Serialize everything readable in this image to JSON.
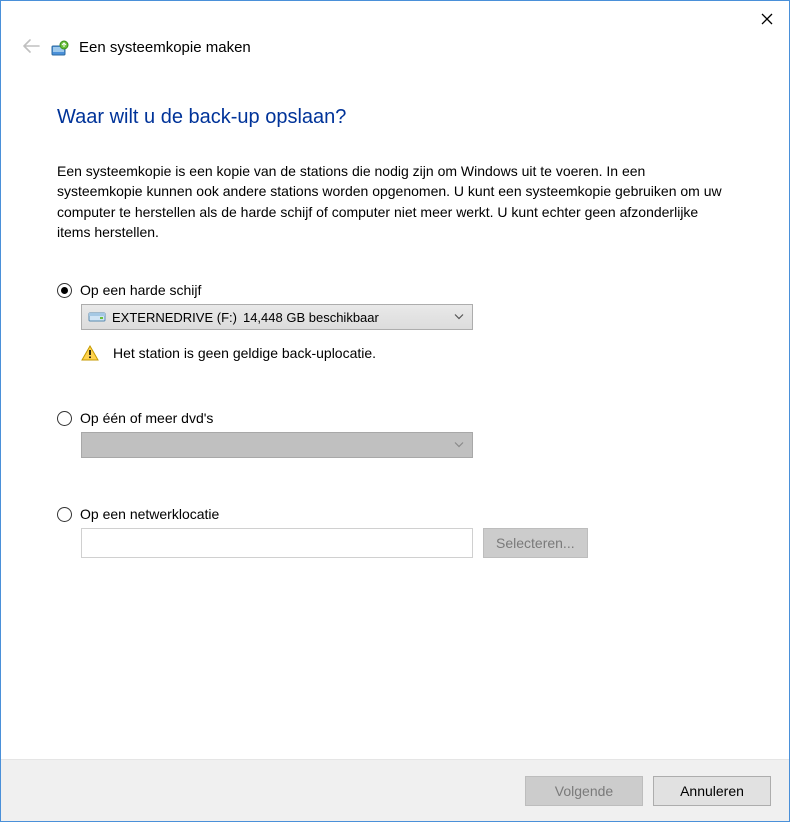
{
  "window": {
    "title": "Een systeemkopie maken"
  },
  "page": {
    "heading": "Waar wilt u de back-up opslaan?",
    "description": "Een systeemkopie is een kopie van de stations die nodig zijn om Windows uit te voeren. In een systeemkopie kunnen ook andere stations worden opgenomen. U kunt een systeemkopie gebruiken om uw computer te herstellen als de harde schijf of computer niet meer werkt. U kunt echter geen afzonderlijke items herstellen."
  },
  "options": {
    "hdd": {
      "label": "Op een harde schijf",
      "selected_drive": "EXTERNEDRIVE (F:)",
      "drive_detail": "14,448 GB beschikbaar",
      "warning": "Het station is geen geldige back-uplocatie."
    },
    "dvd": {
      "label": "Op één of meer dvd's"
    },
    "network": {
      "label": "Op een netwerklocatie",
      "value": "",
      "browse": "Selecteren..."
    }
  },
  "footer": {
    "next": "Volgende",
    "cancel": "Annuleren"
  }
}
